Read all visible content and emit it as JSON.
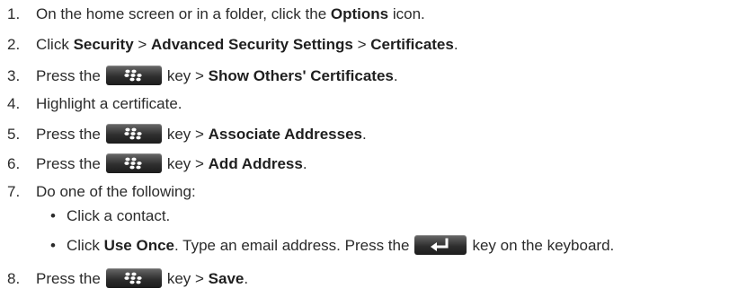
{
  "steps": [
    {
      "num": "1.",
      "pre": "On the home screen or in a folder, click the ",
      "b1": "Options",
      "post": " icon."
    },
    {
      "num": "2.",
      "pre": "Click ",
      "b1": "Security",
      "sep1": " > ",
      "b2": "Advanced Security Settings",
      "sep2": " > ",
      "b3": "Certificates",
      "post": "."
    },
    {
      "num": "3.",
      "pre": "Press the",
      "key": "blackberry-menu-key",
      "mid": "key > ",
      "b1": "Show Others' Certificates",
      "post": "."
    },
    {
      "num": "4.",
      "text": "Highlight a certificate."
    },
    {
      "num": "5.",
      "pre": "Press the",
      "key": "blackberry-menu-key",
      "mid": "key > ",
      "b1": "Associate Addresses",
      "post": "."
    },
    {
      "num": "6.",
      "pre": "Press the",
      "key": "blackberry-menu-key",
      "mid": "key > ",
      "b1": "Add Address",
      "post": "."
    },
    {
      "num": "7.",
      "text": "Do one of the following:"
    },
    {
      "num": "8.",
      "pre": "Press the",
      "key": "blackberry-menu-key",
      "mid": "key > ",
      "b1": "Save",
      "post": "."
    }
  ],
  "bullets": [
    {
      "dot": "•",
      "text": "Click a contact."
    },
    {
      "dot": "•",
      "pre": "Click ",
      "b1": "Use Once",
      "mid": ". Type an email address. Press the",
      "key": "enter-key",
      "post": "key on the keyboard."
    }
  ]
}
